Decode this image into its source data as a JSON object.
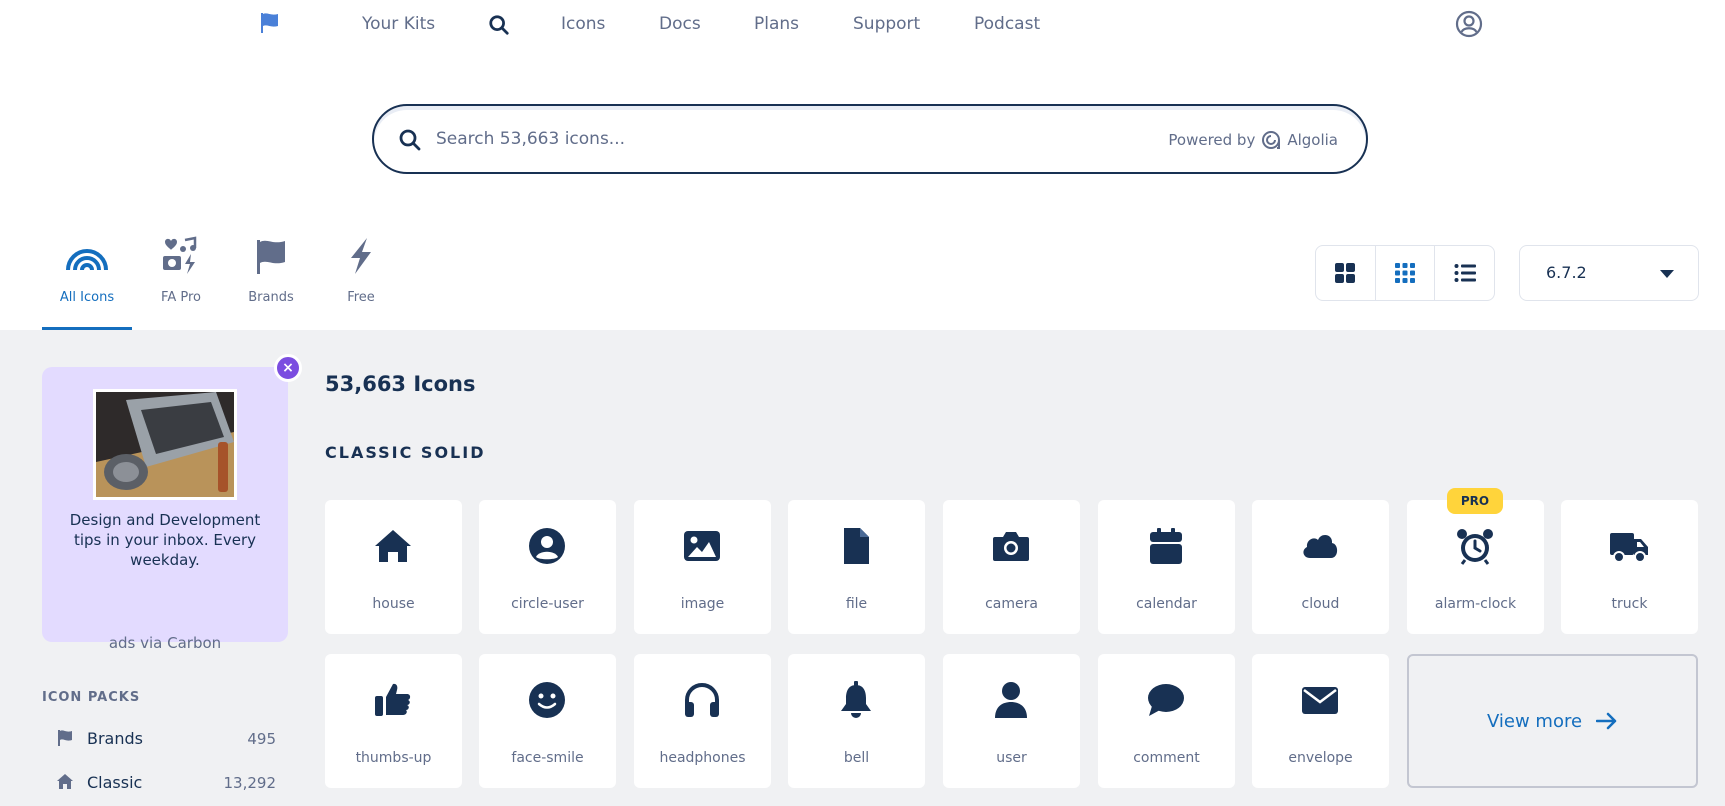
{
  "nav": {
    "links": [
      "Your Kits",
      "Icons",
      "Docs",
      "Plans",
      "Support",
      "Podcast"
    ]
  },
  "search": {
    "placeholder": "Search 53,663 icons...",
    "powered_by": "Powered by",
    "provider": "Algolia"
  },
  "tabs": [
    {
      "label": "All Icons",
      "active": true
    },
    {
      "label": "FA Pro",
      "active": false
    },
    {
      "label": "Brands",
      "active": false
    },
    {
      "label": "Free",
      "active": false
    }
  ],
  "version": "6.7.2",
  "ad": {
    "text": "Design and Development tips in your inbox. Every weekday.",
    "via": "ads via Carbon",
    "close": "×"
  },
  "icon_packs": {
    "title": "ICON PACKS",
    "items": [
      {
        "name": "Brands",
        "count": "495"
      },
      {
        "name": "Classic",
        "count": "13,292"
      }
    ]
  },
  "results": {
    "count_title": "53,663 Icons",
    "section_title": "CLASSIC SOLID",
    "icons": [
      "house",
      "circle-user",
      "image",
      "file",
      "camera",
      "calendar",
      "cloud",
      "alarm-clock",
      "truck",
      "thumbs-up",
      "face-smile",
      "headphones",
      "bell",
      "user",
      "comment",
      "envelope"
    ],
    "pro_badge": "PRO",
    "view_more": "View more"
  },
  "colors": {
    "navy": "#183153",
    "blue": "#146ebe",
    "muted": "#616d8a",
    "gray_bg": "#f0f1f3",
    "ad_bg": "#e3dbff",
    "pro_yellow": "#ffd43b"
  }
}
